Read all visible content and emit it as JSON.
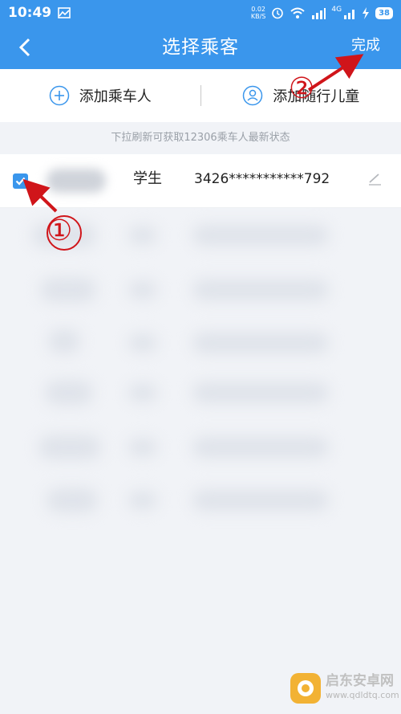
{
  "status_bar": {
    "time": "10:49",
    "net_speed_value": "0.02",
    "net_speed_unit": "KB/S",
    "network_label": "4G",
    "battery": "38"
  },
  "navbar": {
    "title": "选择乘客",
    "done_label": "完成"
  },
  "actions": {
    "add_passenger": "添加乘车人",
    "add_child": "添加随行儿童"
  },
  "hint": "下拉刷新可获取12306乘车人最新状态",
  "passengers": [
    {
      "name": "",
      "type": "学生",
      "id": "3426***********792",
      "checked": true
    }
  ],
  "annotations": {
    "step1": "①",
    "step2": "②"
  },
  "watermark": {
    "title": "启东安卓网",
    "url": "www.qdldtq.com"
  },
  "colors": {
    "accent": "#3a96ec",
    "annotation": "#d0151a"
  }
}
